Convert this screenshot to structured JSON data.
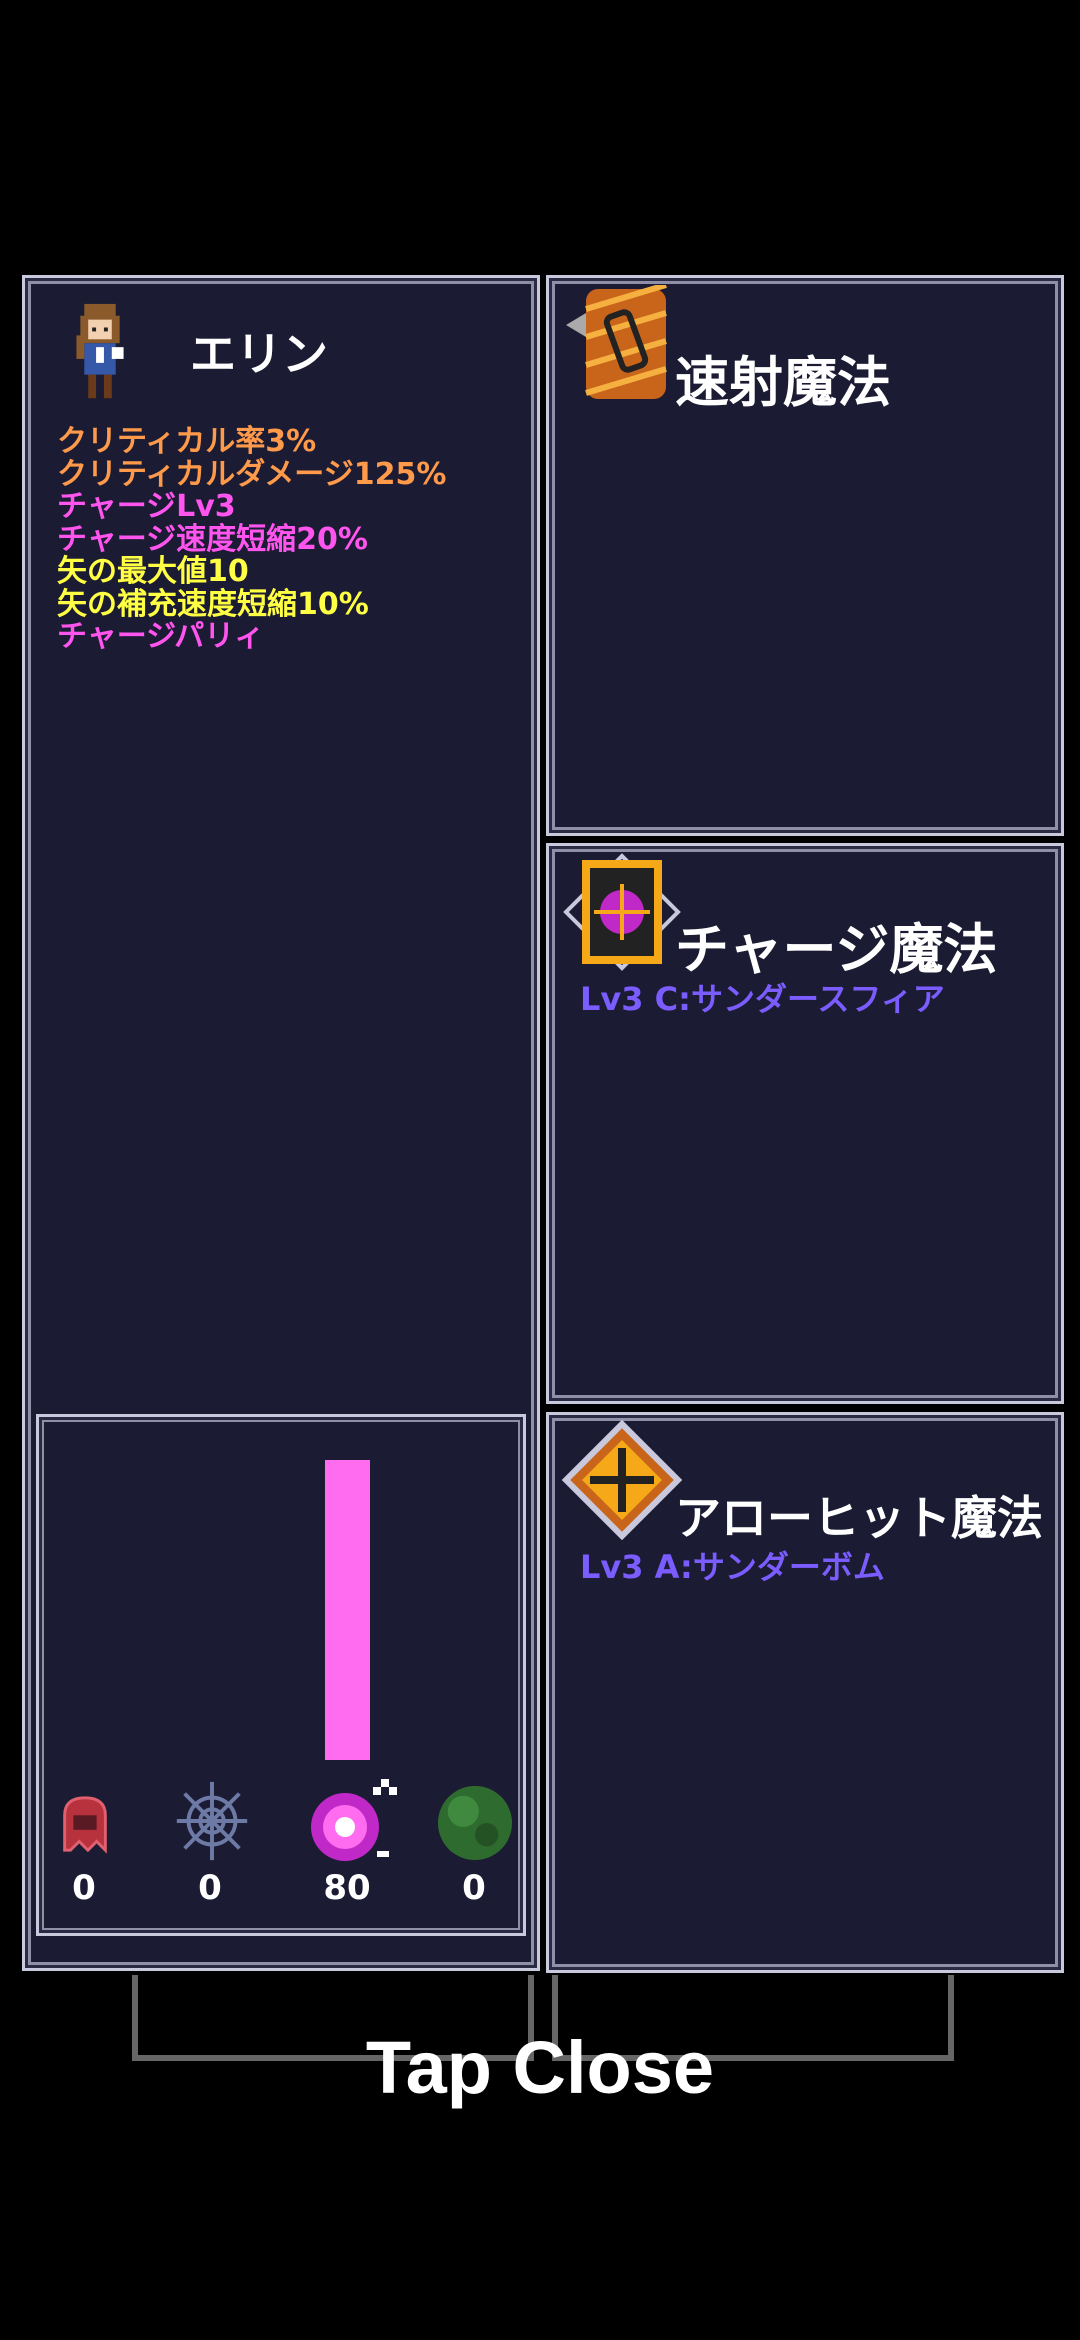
{
  "character": {
    "name": "エリン",
    "stats": [
      {
        "text": "クリティカル率3%",
        "color": "#ff9a4a"
      },
      {
        "text": "クリティカルダメージ125%",
        "color": "#ff9a4a"
      },
      {
        "text": "チャージLv3",
        "color": "#ff55ee"
      },
      {
        "text": "チャージ速度短縮20%",
        "color": "#ff55ee"
      },
      {
        "text": "矢の最大値10",
        "color": "#ffff44"
      },
      {
        "text": "矢の補充速度短縮10%",
        "color": "#ffff44"
      },
      {
        "text": "チャージパリィ",
        "color": "#ff55ee"
      }
    ]
  },
  "magic": {
    "rapid": {
      "title": "速射魔法"
    },
    "charge": {
      "title": "チャージ魔法",
      "sub": "Lv3 C:サンダースフィア"
    },
    "arrowhit": {
      "title": "アローヒット魔法",
      "sub": "Lv3 A:サンダーボム"
    }
  },
  "resources": [
    {
      "name": "ghost-icon",
      "count": "0"
    },
    {
      "name": "web-icon",
      "count": "0"
    },
    {
      "name": "magic-orb-icon",
      "count": "80"
    },
    {
      "name": "slime-icon",
      "count": "0"
    }
  ],
  "gauge_level": 1.0,
  "footer": {
    "tap_close": "Tap Close"
  }
}
